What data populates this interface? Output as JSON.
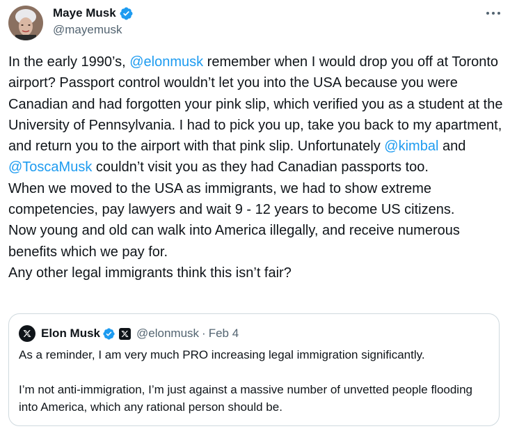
{
  "author": {
    "name": "Maye Musk",
    "handle": "@mayemusk",
    "avatar_icon": "avatar-photo-icon"
  },
  "more_icon": "more-options-icon",
  "tweet": {
    "line1_pre": "In the early 1990’s, ",
    "mention1": "@elonmusk",
    "line1_post": " remember when I would drop you off at Toronto airport? Passport control wouldn’t let you into the USA because you were Canadian and had forgotten your pink slip, which verified you as a student at the University of Pennsylvania. I had to pick you up, take you back to my apartment, and return you to the airport with that pink slip. Unfortunately ",
    "mention2": "@kimbal",
    "and_text": " and ",
    "mention3": "@ToscaMusk",
    "line1_end": " couldn’t visit you as they had Canadian passports too.",
    "para2": "When we moved to the USA as immigrants, we had to show extreme competencies, pay lawyers and wait 9 - 12 years to become US citizens.",
    "para3": "Now young and old can walk into America illegally, and receive numerous benefits which we pay for.",
    "para4": "Any other legal immigrants think this isn’t fair?"
  },
  "quote": {
    "name": "Elon Musk",
    "handle": "@elonmusk",
    "separator": "·",
    "date": "Feb 4",
    "body1": "As a reminder, I am very much PRO increasing legal immigration significantly.",
    "body2": "I’m not anti-immigration, I’m just against a massive number of unvetted people flooding into America, which any rational person should be."
  },
  "colors": {
    "accent": "#1d9bf0",
    "text": "#0f1419",
    "secondary": "#536471",
    "border": "#cfd9de"
  }
}
